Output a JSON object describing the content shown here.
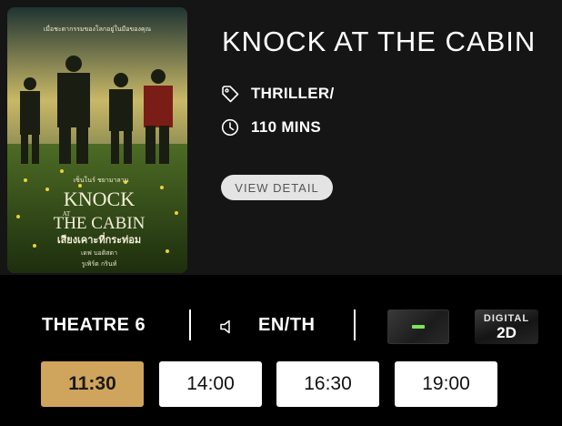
{
  "movie": {
    "title": "KNOCK AT THE CABIN",
    "genre": "THRILLER/",
    "duration": "110 MINS",
    "view_detail_label": "VIEW DETAIL",
    "poster": {
      "tagline_top": "เมื่อชะตากรรมของโลกอยู่ในมือของคุณ",
      "title_line1": "KNOCK",
      "title_line2": "AT",
      "title_line3": "THE CABIN",
      "thai_title": "เสียงเคาะที่กระท่อม",
      "credits_line1": "เซ็นโนร์ ชยามาลาน",
      "credits_line2": "เดฟ บอติสตา",
      "credits_line3": "รูเพิร์ต กรินท์"
    }
  },
  "showtime": {
    "theatre": "THEATRE 6",
    "language": "EN/TH",
    "format_badge_color": "#7ee35a",
    "digital_label_top": "DIGITAL",
    "digital_label_bottom": "2D",
    "times": [
      {
        "label": "11:30",
        "selected": true
      },
      {
        "label": "14:00",
        "selected": false
      },
      {
        "label": "16:30",
        "selected": false
      },
      {
        "label": "19:00",
        "selected": false
      }
    ]
  },
  "colors": {
    "accent": "#cfa45c",
    "card_background": "#151515",
    "page_background": "#000000"
  },
  "icons": {
    "genre": "tag-icon",
    "duration": "clock-icon",
    "audio": "speaker-icon"
  }
}
